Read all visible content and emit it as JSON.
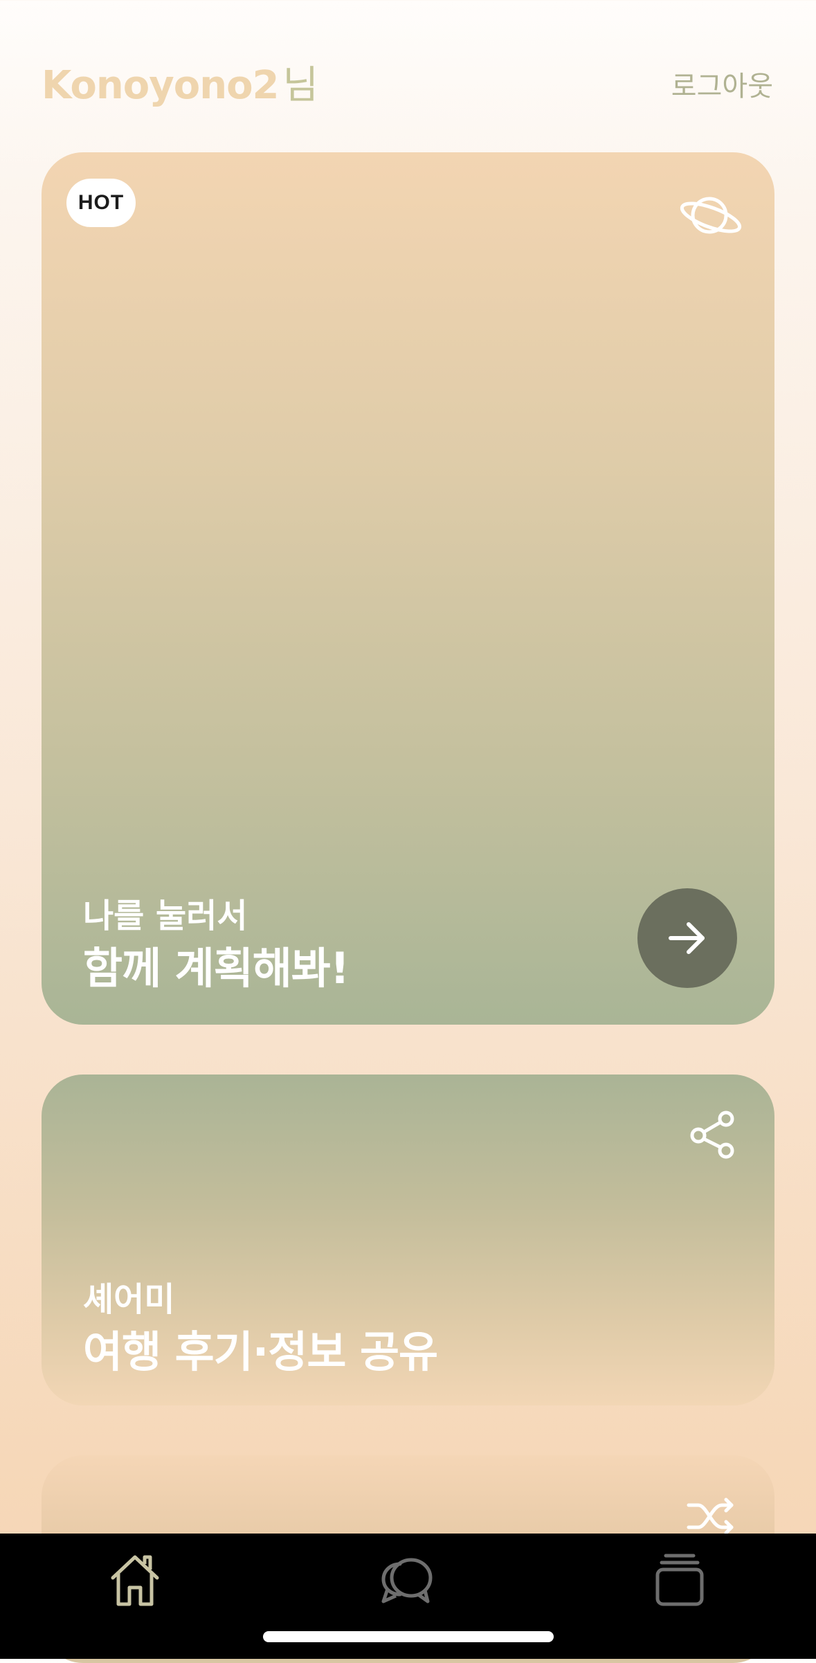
{
  "header": {
    "username": "Konoyono2",
    "honorific": "님",
    "logout_label": "로그아웃"
  },
  "cards": [
    {
      "badge": "HOT",
      "icon": "planet-icon",
      "subtitle": "나를 눌러서",
      "title": "함께 계획해봐!",
      "action_icon": "arrow-right-icon"
    },
    {
      "icon": "share-icon",
      "subtitle": "셰어미",
      "title": "여행 후기·정보 공유"
    },
    {
      "icon": "shuffle-icon"
    }
  ],
  "tabbar": {
    "items": [
      {
        "icon": "home-icon",
        "active": true
      },
      {
        "icon": "chat-icon",
        "active": false
      },
      {
        "icon": "cards-stack-icon",
        "active": false
      }
    ]
  },
  "colors": {
    "username": "#efd5ae",
    "logout": "#b0b292",
    "action_button": "#6b6f5e",
    "tab_active": "#c8c4a4",
    "tab_inactive": "#6e6e6e"
  }
}
